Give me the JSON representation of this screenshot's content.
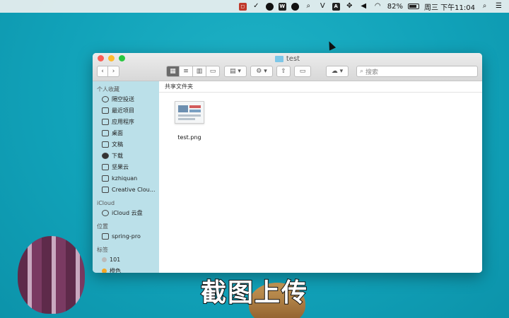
{
  "menubar": {
    "battery_percent": "82%",
    "datetime": "周三 下午11:04",
    "icons": [
      "app-icon",
      "check-circle-icon",
      "dark-circle-icon",
      "w-icon",
      "refresh-icon",
      "search-circle-icon",
      "vee-icon",
      "a-icon",
      "move-icon",
      "volume-icon",
      "wifi-icon",
      "battery-icon",
      "search-icon",
      "menu-list-icon"
    ]
  },
  "window": {
    "title": "test",
    "search_placeholder": "搜索"
  },
  "sidebar": {
    "favorites_header": "个人收藏",
    "favorites": [
      {
        "label": "隔空投送",
        "icon": "airdrop-icon"
      },
      {
        "label": "最近项目",
        "icon": "recent-icon"
      },
      {
        "label": "应用程序",
        "icon": "applications-icon"
      },
      {
        "label": "桌面",
        "icon": "desktop-icon"
      },
      {
        "label": "文稿",
        "icon": "documents-icon"
      },
      {
        "label": "下载",
        "icon": "downloads-icon"
      },
      {
        "label": "坚果云",
        "icon": "folder-icon"
      },
      {
        "label": "kzhiquan",
        "icon": "home-icon"
      },
      {
        "label": "Creative Clou...",
        "icon": "folder-icon"
      }
    ],
    "icloud_header": "iCloud",
    "icloud": [
      {
        "label": "iCloud 云盘",
        "icon": "cloud-icon"
      }
    ],
    "locations_header": "位置",
    "locations": [
      {
        "label": "spring-pro",
        "icon": "drive-icon"
      }
    ],
    "tags_header": "标签",
    "tags": [
      {
        "label": "101",
        "color": "#bbbbbb"
      },
      {
        "label": "橙色",
        "color": "#f5a623"
      }
    ]
  },
  "main": {
    "path": "共享文件夹",
    "files": [
      {
        "name": "test.png"
      }
    ]
  },
  "caption": "截图上传"
}
